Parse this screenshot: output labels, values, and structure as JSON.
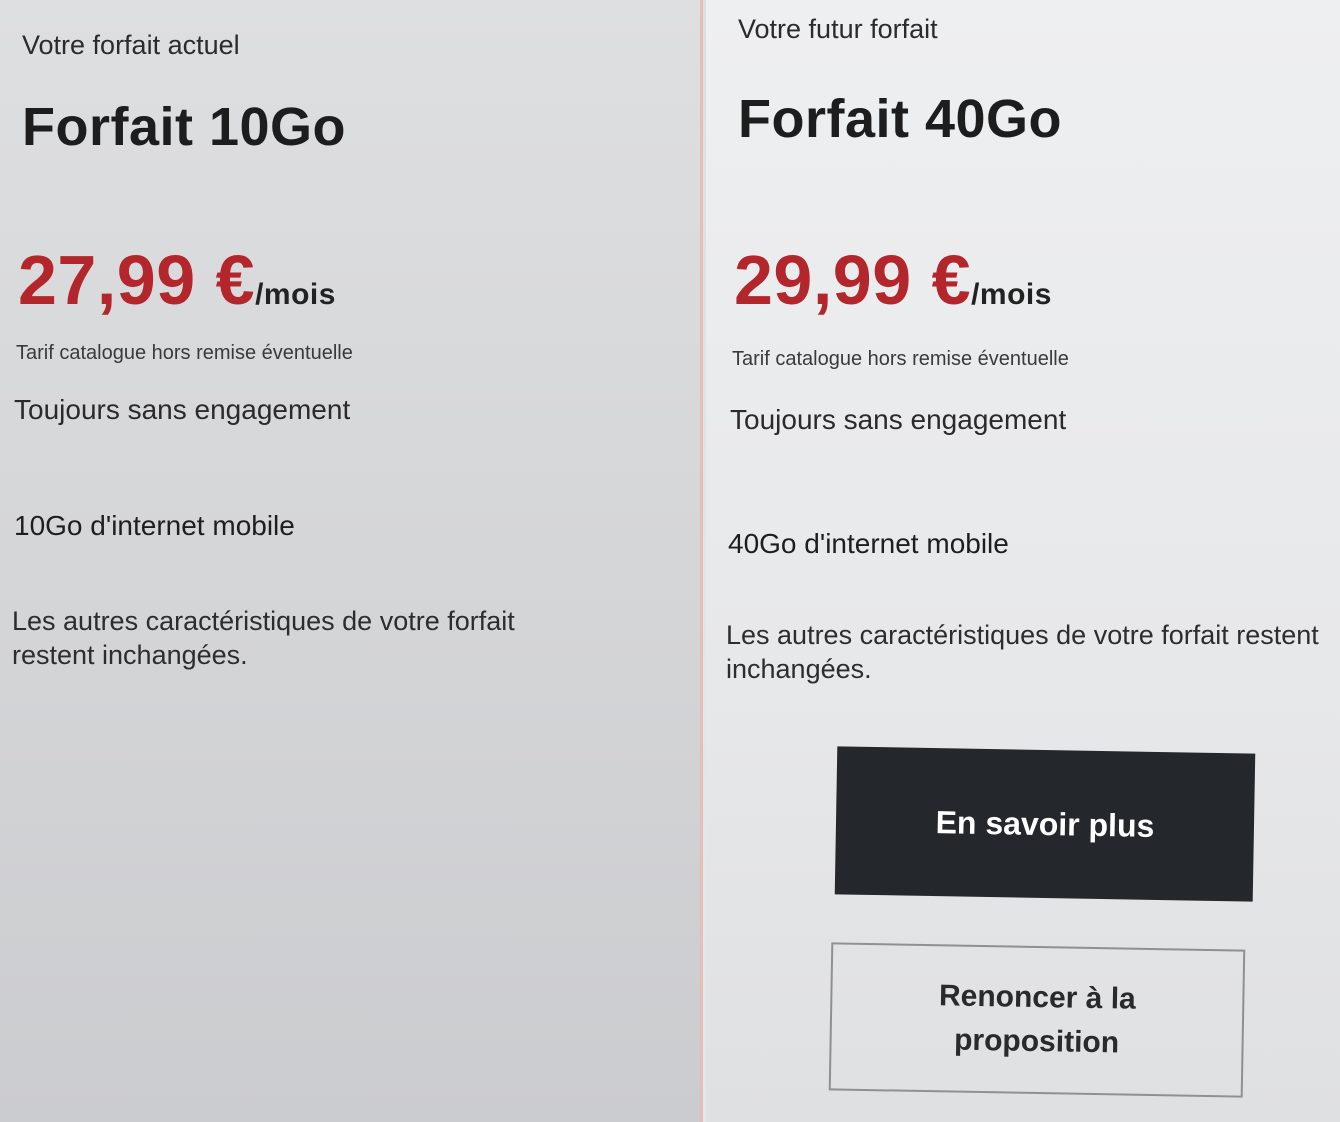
{
  "current_plan": {
    "heading": "Votre forfait actuel",
    "title": "Forfait 10Go",
    "price_amount": "27,99 €",
    "price_unit": "/mois",
    "price_note": "Tarif catalogue hors remise éventuelle",
    "commitment": "Toujours sans engagement",
    "data_allowance": "10Go d'internet mobile",
    "other_features": "Les autres caractéristiques de votre forfait restent inchangées."
  },
  "future_plan": {
    "heading": "Votre futur forfait",
    "title": "Forfait 40Go",
    "price_amount": "29,99 €",
    "price_unit": "/mois",
    "price_note": "Tarif catalogue hors remise éventuelle",
    "commitment": "Toujours sans engagement",
    "data_allowance": "40Go d'internet mobile",
    "other_features": "Les autres caractéristiques de votre forfait restent inchangées."
  },
  "actions": {
    "learn_more_label": "En savoir plus",
    "decline_label": "Renoncer à la proposition"
  },
  "colors": {
    "price": "#b3262b",
    "primary_button": "#24272b",
    "divider": "#e2c1b4"
  }
}
